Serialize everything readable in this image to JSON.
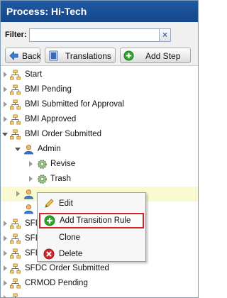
{
  "title": "Process: Hi-Tech",
  "filter": {
    "label": "Filter:",
    "value": "",
    "clear_glyph": "×"
  },
  "toolbar": {
    "back": "Back",
    "translations": "Translations",
    "add_step": "Add Step"
  },
  "tree": {
    "start": "Start",
    "bmi_pending": "BMI Pending",
    "bmi_submitted": "BMI Submitted for Approval",
    "bmi_approved": "BMI Approved",
    "bmi_order_submitted": "BMI Order Submitted",
    "admin": "Admin",
    "revise": "Revise",
    "trash": "Trash",
    "row_sfdc_a": "SFD",
    "row_sfdc_b": "SFD",
    "row_sfdc_c": "SFD",
    "sfdc_order_submitted": "SFDC Order Submitted",
    "crmod_pending": "CRMOD Pending"
  },
  "context_menu": {
    "edit": "Edit",
    "add_transition_rule": "Add Transition Rule",
    "clone": "Clone",
    "delete": "Delete"
  },
  "colors": {
    "title_bar": "#1f5aa5",
    "highlight_border": "#d9232b",
    "selected_row": "#fafad2"
  }
}
